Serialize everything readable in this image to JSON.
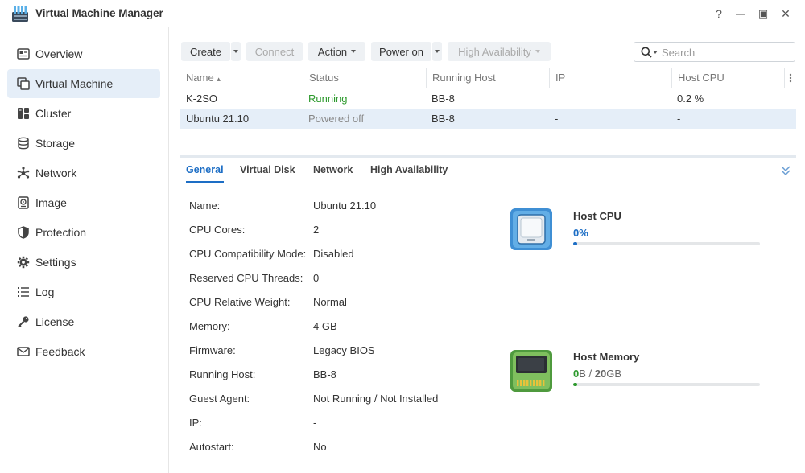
{
  "window": {
    "title": "Virtual Machine Manager",
    "controls": {
      "help": "?",
      "minimize": "—",
      "maximize": "▣",
      "close": "✕"
    }
  },
  "sidebar": {
    "items": [
      {
        "label": "Overview",
        "icon": "overview-icon"
      },
      {
        "label": "Virtual Machine",
        "icon": "virtual-machine-icon",
        "active": true
      },
      {
        "label": "Cluster",
        "icon": "cluster-icon"
      },
      {
        "label": "Storage",
        "icon": "storage-icon"
      },
      {
        "label": "Network",
        "icon": "network-icon"
      },
      {
        "label": "Image",
        "icon": "image-icon"
      },
      {
        "label": "Protection",
        "icon": "shield-icon"
      },
      {
        "label": "Settings",
        "icon": "gear-icon"
      },
      {
        "label": "Log",
        "icon": "log-icon"
      },
      {
        "label": "License",
        "icon": "key-icon"
      },
      {
        "label": "Feedback",
        "icon": "mail-icon"
      }
    ]
  },
  "toolbar": {
    "create": "Create",
    "connect": "Connect",
    "action": "Action",
    "power_on": "Power on",
    "high_availability": "High Availability",
    "search_placeholder": "Search"
  },
  "table": {
    "columns": [
      "Name",
      "Status",
      "Running Host",
      "IP",
      "Host CPU"
    ],
    "sort_indicator": "▴",
    "rows": [
      {
        "name": "K-2SO",
        "status": "Running",
        "host": "BB-8",
        "ip": "",
        "cpu": "0.2 %"
      },
      {
        "name": "Ubuntu 21.10",
        "status": "Powered off",
        "host": "BB-8",
        "ip": "-",
        "cpu": "-"
      }
    ]
  },
  "detail": {
    "tabs": [
      "General",
      "Virtual Disk",
      "Network",
      "High Availability"
    ],
    "properties": [
      {
        "label": "Name:",
        "value": "Ubuntu 21.10"
      },
      {
        "label": "CPU Cores:",
        "value": "2"
      },
      {
        "label": "CPU Compatibility Mode:",
        "value": "Disabled"
      },
      {
        "label": "Reserved CPU Threads:",
        "value": "0"
      },
      {
        "label": "CPU Relative Weight:",
        "value": "Normal"
      },
      {
        "label": "Memory:",
        "value": "4 GB"
      },
      {
        "label": "Firmware:",
        "value": "Legacy BIOS"
      },
      {
        "label": "Running Host:",
        "value": "BB-8"
      },
      {
        "label": "Guest Agent:",
        "value": "Not Running / Not Installed"
      },
      {
        "label": "IP:",
        "value": "-"
      },
      {
        "label": "Autostart:",
        "value": "No"
      }
    ],
    "host_cpu": {
      "title": "Host CPU",
      "value": "0",
      "unit": "%",
      "percent": 0
    },
    "host_memory": {
      "title": "Host Memory",
      "used": "0",
      "used_unit": "B",
      "sep": "/",
      "total": "20",
      "total_unit": "GB",
      "percent": 0
    }
  },
  "colors": {
    "accent_blue": "#1d6ec5",
    "running_green": "#2d9a2d",
    "selected_bg": "#e5eef8",
    "cpu_bar": "#1d6ec5",
    "memory_bar": "#2d9a2d"
  }
}
